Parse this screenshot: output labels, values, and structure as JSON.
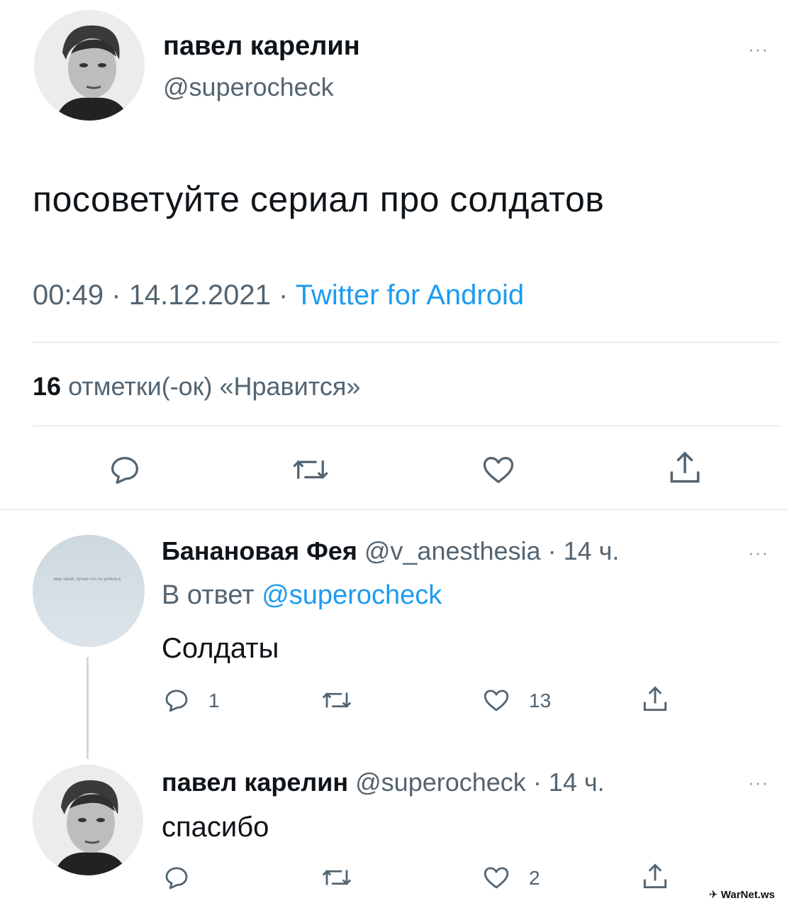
{
  "main_tweet": {
    "author_name": "павел карелин",
    "author_handle": "@superocheck",
    "text": "посоветуйте сериал про солдатов",
    "time": "00:49",
    "separator": "·",
    "date": "14.12.2021",
    "source": "Twitter for Android",
    "likes_count": "16",
    "likes_label": "отметки(-ок) «Нравится»",
    "more_label": "···"
  },
  "replies": [
    {
      "author_name": "Банановая Фея",
      "author_handle": "@v_anesthesia",
      "time": "· 14 ч.",
      "reply_prefix": "В ответ",
      "reply_to": "@superocheck",
      "text": "Солдаты",
      "reply_count": "1",
      "retweet_count": "",
      "like_count": "13",
      "more_label": "···",
      "avatar_caption": "мир такой, лучше что ты успела в"
    },
    {
      "author_name": "павел карелин",
      "author_handle": "@superocheck",
      "time": "· 14 ч.",
      "text": "спасибо",
      "reply_count": "",
      "retweet_count": "",
      "like_count": "2",
      "more_label": "···"
    }
  ],
  "watermark": "WarNet.ws",
  "colors": {
    "text": "#0f1419",
    "secondary": "#536471",
    "link": "#1d9bf0",
    "divider": "#dcdfe2"
  },
  "icons": [
    "reply-icon",
    "retweet-icon",
    "like-icon",
    "share-icon",
    "more-icon"
  ]
}
